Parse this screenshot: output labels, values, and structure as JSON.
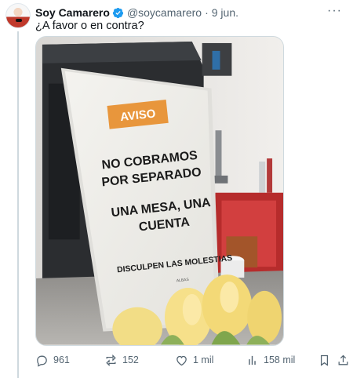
{
  "tweet": {
    "author_name": "Soy Camarero",
    "handle": "@soycamarero",
    "separator": "·",
    "time": "9 jun.",
    "more_label": "···",
    "text": "¿A favor o en contra?"
  },
  "sign": {
    "badge": "AVISO",
    "line1": "NO COBRAMOS",
    "line2": "POR SEPARADO",
    "line3": "UNA MESA, UNA",
    "line4": "CUENTA",
    "line5": "DISCULPEN LAS MOLESTIAS",
    "footer": "ALBAS"
  },
  "actions": {
    "replies": "961",
    "reposts": "152",
    "likes": "1 mil",
    "views": "158 mil"
  },
  "colors": {
    "verified": "#1d9bf0",
    "secondary_text": "#536471",
    "sign_badge": "#e8963c"
  },
  "icons": [
    "verified-badge-icon",
    "more-icon",
    "reply-icon",
    "repost-icon",
    "like-icon",
    "views-icon",
    "bookmark-icon",
    "share-icon"
  ]
}
